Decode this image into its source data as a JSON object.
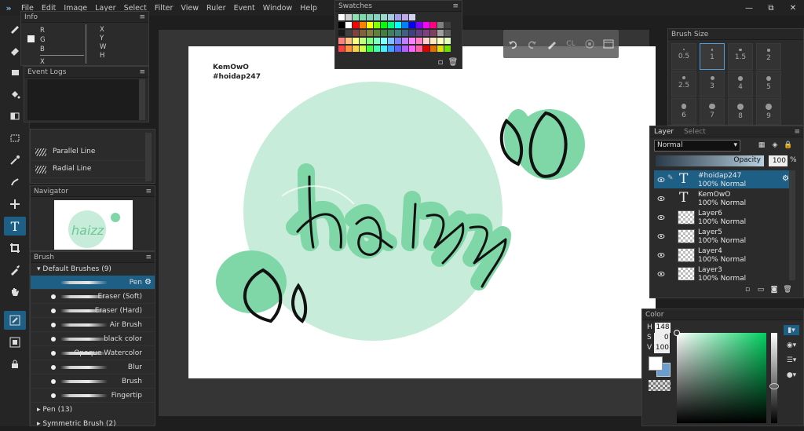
{
  "menu": {
    "items": [
      "File",
      "Edit",
      "Image",
      "Layer",
      "Select",
      "Filter",
      "View",
      "Ruler",
      "Event",
      "Window",
      "Help"
    ]
  },
  "window_controls": {
    "min": "—",
    "max": "⧉",
    "close": "✕"
  },
  "info": {
    "title": "Info",
    "left_labels": [
      "R",
      "G",
      "B",
      "X"
    ],
    "right_labels": [
      "X",
      "Y",
      "W",
      "H"
    ]
  },
  "event_logs": {
    "title": "Event Logs"
  },
  "ruler_items": [
    {
      "label": "Parallel Line"
    },
    {
      "label": "Radial Line"
    }
  ],
  "navigator": {
    "title": "Navigator"
  },
  "brush": {
    "title": "Brush",
    "group": "Default Brushes (9)",
    "items": [
      "Pen",
      "Eraser (Soft)",
      "Eraser (Hard)",
      "Air Brush",
      "black color",
      "Opaque Watercolor",
      "Blur",
      "Brush",
      "Fingertip"
    ],
    "more_groups": [
      "Pen (13)",
      "Symmetric Brush (2)"
    ]
  },
  "swatches": {
    "title": "Swatches",
    "rows": [
      [
        "#ffffff",
        "#cfcfcf",
        "#8fe0b0",
        "#7fd6a8",
        "#86d0b8",
        "#8ad0c0",
        "#9ad8c8",
        "#a8c8e0",
        "#a0a0e8",
        "#c0a8e8",
        "#d0d0f0"
      ],
      [
        "#000000",
        "#ffffff",
        "#ff0000",
        "#ff8000",
        "#ffff00",
        "#80ff00",
        "#00ff00",
        "#00ff80",
        "#00ffff",
        "#0080ff",
        "#0000ff",
        "#8000ff",
        "#ff00ff",
        "#ff0080",
        "#808080",
        "#404040"
      ],
      [
        "#1a1a1a",
        "#404040",
        "#804040",
        "#806040",
        "#808040",
        "#608040",
        "#408040",
        "#408060",
        "#408080",
        "#406080",
        "#404080",
        "#604080",
        "#804080",
        "#804060",
        "#a0a0a0",
        "#606060"
      ],
      [
        "#ff8080",
        "#ffc080",
        "#ffff80",
        "#c0ff80",
        "#80ff80",
        "#80ffc0",
        "#80ffff",
        "#80c0ff",
        "#8080ff",
        "#c080ff",
        "#ff80ff",
        "#ff80c0",
        "#ffd0d0",
        "#ffe8c0",
        "#ffffc0",
        "#e0ffc0"
      ],
      [
        "#ff4040",
        "#ff9040",
        "#ffd040",
        "#d0ff40",
        "#40ff40",
        "#40ffb0",
        "#40f0ff",
        "#40a0ff",
        "#6060ff",
        "#b060ff",
        "#ff60ff",
        "#ff60a0",
        "#e00000",
        "#e07000",
        "#e0e000",
        "#70e000"
      ]
    ]
  },
  "canvas_text": {
    "line1": "KemOwO",
    "line2": "#hoidap247"
  },
  "canvas_art": {
    "word": "haizz"
  },
  "float_toolbar": {
    "icons": [
      "undo-icon",
      "redo-icon",
      "pen-icon",
      "clear-icon",
      "target-icon",
      "panel-icon"
    ],
    "cl_label": "CL"
  },
  "brush_size": {
    "title": "Brush Size",
    "sizes": [
      "0.5",
      "1",
      "1.5",
      "2",
      "2.5",
      "3",
      "4",
      "5",
      "6",
      "7",
      "8",
      "9"
    ],
    "selected": "1"
  },
  "layers": {
    "tab_layer": "Layer",
    "tab_select": "Select",
    "blend_mode": "Normal",
    "opacity_label": "Opacity",
    "opacity_value": "100",
    "opacity_unit": "%",
    "rows": [
      {
        "name": "#hoidap247",
        "mode": "100% Normal",
        "type": "text",
        "selected": true
      },
      {
        "name": "KemOwO",
        "mode": "100% Normal",
        "type": "text",
        "selected": false
      },
      {
        "name": "Layer6",
        "mode": "100% Normal",
        "type": "raster",
        "selected": false
      },
      {
        "name": "Layer5",
        "mode": "100% Normal",
        "type": "raster",
        "selected": false
      },
      {
        "name": "Layer4",
        "mode": "100% Normal",
        "type": "raster",
        "selected": false
      },
      {
        "name": "Layer3",
        "mode": "100% Normal",
        "type": "raster",
        "selected": false
      }
    ]
  },
  "color": {
    "title": "Color",
    "h_label": "H",
    "h": "148",
    "s_label": "S",
    "s": "0",
    "v_label": "V",
    "v": "100",
    "accent": "#1e5f86"
  }
}
